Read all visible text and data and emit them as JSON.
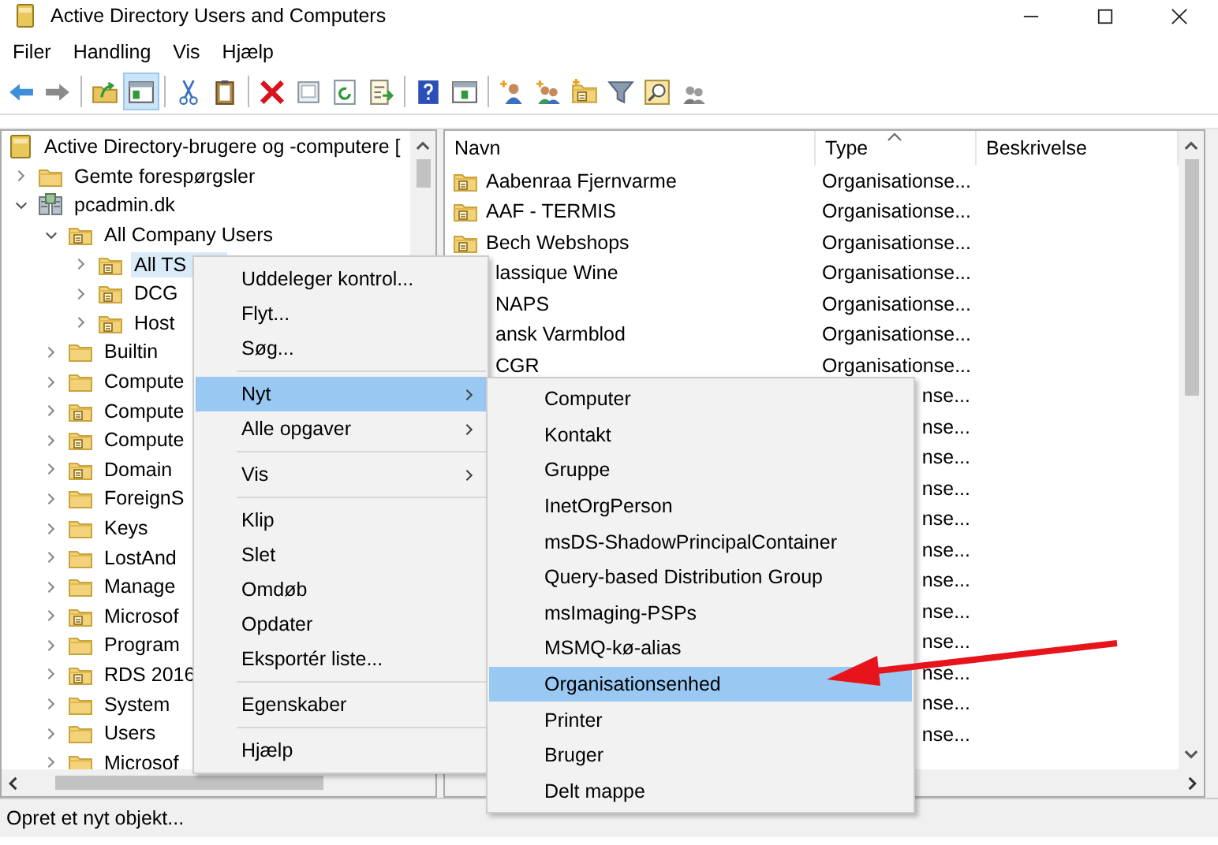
{
  "window": {
    "title": "Active Directory Users and Computers"
  },
  "menu_bar": [
    "Filer",
    "Handling",
    "Vis",
    "Hjælp"
  ],
  "toolbar": [
    {
      "kind": "back",
      "pressed": false
    },
    {
      "kind": "forward",
      "pressed": false
    },
    {
      "kind": "separator"
    },
    {
      "kind": "folder-up",
      "pressed": false
    },
    {
      "kind": "panel",
      "pressed": true
    },
    {
      "kind": "separator"
    },
    {
      "kind": "cut",
      "pressed": false
    },
    {
      "kind": "paste",
      "pressed": false
    },
    {
      "kind": "separator"
    },
    {
      "kind": "delete",
      "pressed": false
    },
    {
      "kind": "properties",
      "pressed": false
    },
    {
      "kind": "refresh",
      "pressed": false
    },
    {
      "kind": "export",
      "pressed": false
    },
    {
      "kind": "separator"
    },
    {
      "kind": "help",
      "pressed": false
    },
    {
      "kind": "panel-right",
      "pressed": false
    },
    {
      "kind": "separator"
    },
    {
      "kind": "new-user",
      "pressed": false
    },
    {
      "kind": "new-group",
      "pressed": false
    },
    {
      "kind": "new-ou",
      "pressed": false
    },
    {
      "kind": "filter",
      "pressed": false
    },
    {
      "kind": "find",
      "pressed": false
    },
    {
      "kind": "add-group",
      "pressed": false
    }
  ],
  "tree": {
    "label": "Active Directory-brugere og -computere [",
    "kind": "root",
    "children": [
      {
        "label": "Gemte forespørgsler",
        "kind": "container",
        "expanded": false,
        "selected": false
      },
      {
        "label": "pcadmin.dk",
        "kind": "domain",
        "expanded": true,
        "selected": false,
        "children": [
          {
            "label": "All Company Users",
            "kind": "ou",
            "expanded": true,
            "selected": false,
            "children": [
              {
                "label": "All TS",
                "kind": "ou",
                "expanded": false,
                "selected": true
              },
              {
                "label": "DCG",
                "kind": "ou",
                "expanded": false,
                "selected": false
              },
              {
                "label": "Host",
                "kind": "ou",
                "expanded": false,
                "selected": false
              }
            ]
          },
          {
            "label": "Builtin",
            "kind": "container",
            "expanded": false,
            "selected": false
          },
          {
            "label": "Compute",
            "kind": "container",
            "expanded": false,
            "selected": false
          },
          {
            "label": "Compute",
            "kind": "ou",
            "expanded": false,
            "selected": false
          },
          {
            "label": "Compute",
            "kind": "ou",
            "expanded": false,
            "selected": false
          },
          {
            "label": "Domain",
            "kind": "ou",
            "expanded": false,
            "selected": false
          },
          {
            "label": "ForeignS",
            "kind": "container",
            "expanded": false,
            "selected": false
          },
          {
            "label": "Keys",
            "kind": "container",
            "expanded": false,
            "selected": false
          },
          {
            "label": "LostAnd",
            "kind": "container",
            "expanded": false,
            "selected": false
          },
          {
            "label": "Manage",
            "kind": "container",
            "expanded": false,
            "selected": false
          },
          {
            "label": "Microsof",
            "kind": "ou",
            "expanded": false,
            "selected": false
          },
          {
            "label": "Program",
            "kind": "container",
            "expanded": false,
            "selected": false
          },
          {
            "label": "RDS 2016",
            "kind": "ou",
            "expanded": false,
            "selected": false
          },
          {
            "label": "System",
            "kind": "container",
            "expanded": false,
            "selected": false
          },
          {
            "label": "Users",
            "kind": "container",
            "expanded": false,
            "selected": false
          },
          {
            "label": "Microsof",
            "kind": "container",
            "expanded": false,
            "selected": false
          }
        ]
      }
    ]
  },
  "table": {
    "columns": [
      "Navn",
      "Type",
      "Beskrivelse"
    ],
    "rows": [
      {
        "kind": "ou",
        "name": "Aabenraa Fjernvarme",
        "type": "Organisationse..."
      },
      {
        "kind": "ou",
        "name": "AAF - TERMIS",
        "type": "Organisationse..."
      },
      {
        "kind": "ou",
        "name": "Bech Webshops",
        "type": "Organisationse..."
      },
      {
        "kind": "text",
        "name": "lassique Wine",
        "type": "Organisationse..."
      },
      {
        "kind": "text",
        "name": "NAPS",
        "type": "Organisationse..."
      },
      {
        "kind": "text",
        "name": "ansk Varmblod",
        "type": "Organisationse..."
      },
      {
        "kind": "text",
        "name": "CGR",
        "type": "Organisationse..."
      },
      {
        "kind": "type-only",
        "type": "nse..."
      },
      {
        "kind": "type-only",
        "type": "nse..."
      },
      {
        "kind": "type-only",
        "type": "nse..."
      },
      {
        "kind": "type-only",
        "type": "nse..."
      },
      {
        "kind": "type-only",
        "type": "nse..."
      },
      {
        "kind": "type-only",
        "type": "nse..."
      },
      {
        "kind": "type-only",
        "type": "nse..."
      },
      {
        "kind": "type-only",
        "type": "nse..."
      },
      {
        "kind": "type-only",
        "type": "nse..."
      },
      {
        "kind": "type-only",
        "type": "nse..."
      },
      {
        "kind": "type-only",
        "type": "nse..."
      },
      {
        "kind": "type-only",
        "type": "nse..."
      }
    ]
  },
  "context_menu": {
    "items": [
      {
        "kind": "item",
        "label": "Uddeleger kontrol...",
        "submenu": false,
        "selected": false
      },
      {
        "kind": "item",
        "label": "Flyt...",
        "submenu": false,
        "selected": false
      },
      {
        "kind": "item",
        "label": "Søg...",
        "submenu": false,
        "selected": false
      },
      {
        "kind": "separator"
      },
      {
        "kind": "item",
        "label": "Nyt",
        "submenu": true,
        "selected": true
      },
      {
        "kind": "item",
        "label": "Alle opgaver",
        "submenu": true,
        "selected": false
      },
      {
        "kind": "separator"
      },
      {
        "kind": "item",
        "label": "Vis",
        "submenu": true,
        "selected": false
      },
      {
        "kind": "separator"
      },
      {
        "kind": "item",
        "label": "Klip",
        "submenu": false,
        "selected": false
      },
      {
        "kind": "item",
        "label": "Slet",
        "submenu": false,
        "selected": false
      },
      {
        "kind": "item",
        "label": "Omdøb",
        "submenu": false,
        "selected": false
      },
      {
        "kind": "item",
        "label": "Opdater",
        "submenu": false,
        "selected": false
      },
      {
        "kind": "item",
        "label": "Eksportér liste...",
        "submenu": false,
        "selected": false
      },
      {
        "kind": "separator"
      },
      {
        "kind": "item",
        "label": "Egenskaber",
        "submenu": false,
        "selected": false
      },
      {
        "kind": "separator"
      },
      {
        "kind": "item",
        "label": "Hjælp",
        "submenu": false,
        "selected": false
      }
    ]
  },
  "submenu": {
    "items": [
      {
        "label": "Computer",
        "selected": false
      },
      {
        "label": "Kontakt",
        "selected": false
      },
      {
        "label": "Gruppe",
        "selected": false
      },
      {
        "label": "InetOrgPerson",
        "selected": false
      },
      {
        "label": "msDS-ShadowPrincipalContainer",
        "selected": false
      },
      {
        "label": "Query-based Distribution Group",
        "selected": false
      },
      {
        "label": "msImaging-PSPs",
        "selected": false
      },
      {
        "label": "MSMQ-kø-alias",
        "selected": false
      },
      {
        "label": "Organisationsenhed",
        "selected": true
      },
      {
        "label": "Printer",
        "selected": false
      },
      {
        "label": "Bruger",
        "selected": false
      },
      {
        "label": "Delt mappe",
        "selected": false
      }
    ]
  },
  "status_bar": "Opret et nyt objekt..."
}
